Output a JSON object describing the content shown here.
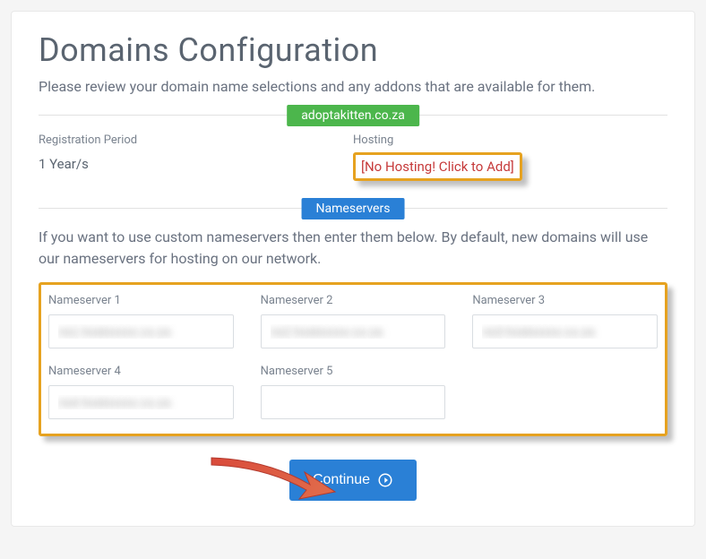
{
  "header": {
    "title": "Domains Configuration",
    "subtitle": "Please review your domain name selections and any addons that are available for them."
  },
  "domain": {
    "name": "adoptakitten.co.za",
    "registration_label": "Registration Period",
    "registration_value": "1 Year/s",
    "hosting_label": "Hosting",
    "hosting_value": "[No Hosting! Click to Add]"
  },
  "nameservers": {
    "section_title": "Nameservers",
    "help": "If you want to use custom nameservers then enter them below. By default, new domains will use our nameservers for hosting on our network.",
    "fields": [
      {
        "label": "Nameserver 1",
        "value": "ns1.hostxxxxx.co.za"
      },
      {
        "label": "Nameserver 2",
        "value": "ns2.hostxxxxx.co.za"
      },
      {
        "label": "Nameserver 3",
        "value": "ns3.hostxxxxx.co.za"
      },
      {
        "label": "Nameserver 4",
        "value": "ns4.hostxxxxx.co.za"
      },
      {
        "label": "Nameserver 5",
        "value": ""
      }
    ]
  },
  "actions": {
    "continue_label": "Continue"
  }
}
